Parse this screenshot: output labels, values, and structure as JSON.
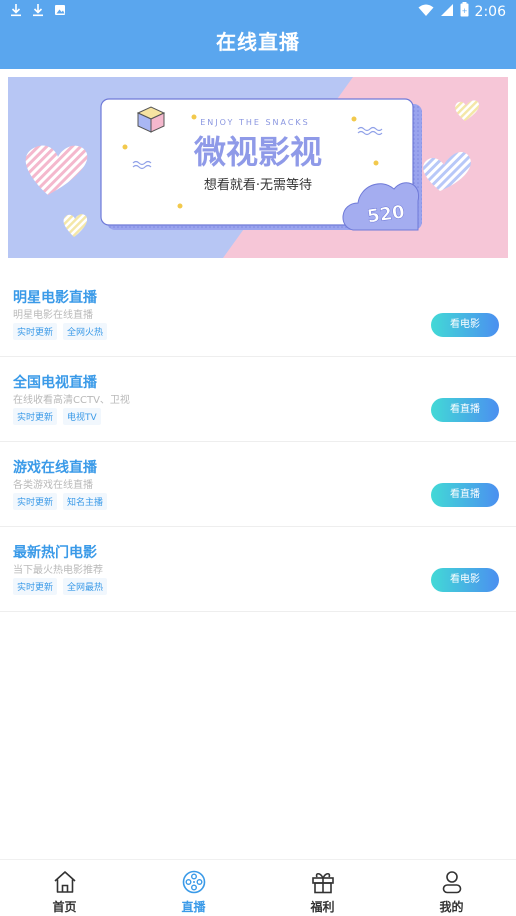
{
  "status_bar": {
    "time": "2:06",
    "left_icons": [
      "download-icon",
      "download-icon",
      "image-icon"
    ],
    "right_icons": [
      "wifi-icon",
      "signal-icon",
      "battery-icon"
    ]
  },
  "header": {
    "title": "在线直播"
  },
  "banner": {
    "tagline_en": "ENJOY THE SNACKS",
    "brand": "微视影视",
    "slogan": "想看就看·无需等待",
    "badge": "520",
    "colors": {
      "left": "#b7c6f4",
      "right": "#f6c6d7"
    }
  },
  "items": [
    {
      "title": "明星电影直播",
      "subtitle": "明星电影在线直播",
      "tags": [
        "实时更新",
        "全网火热"
      ],
      "button": "看电影"
    },
    {
      "title": "全国电视直播",
      "subtitle": "在线收看高清CCTV、卫视",
      "tags": [
        "实时更新",
        "电视TV"
      ],
      "button": "看直播"
    },
    {
      "title": "游戏在线直播",
      "subtitle": "各类游戏在线直播",
      "tags": [
        "实时更新",
        "知名主播"
      ],
      "button": "看直播"
    },
    {
      "title": "最新热门电影",
      "subtitle": "当下最火热电影推荐",
      "tags": [
        "实时更新",
        "全网最热"
      ],
      "button": "看电影"
    }
  ],
  "tabbar": {
    "items": [
      {
        "label": "首页",
        "icon": "home-icon",
        "active": false
      },
      {
        "label": "直播",
        "icon": "film-reel-icon",
        "active": true
      },
      {
        "label": "福利",
        "icon": "gift-icon",
        "active": false
      },
      {
        "label": "我的",
        "icon": "user-icon",
        "active": false
      }
    ]
  },
  "colors": {
    "primary": "#5aa6ee",
    "accent_text": "#3a9ae8"
  }
}
